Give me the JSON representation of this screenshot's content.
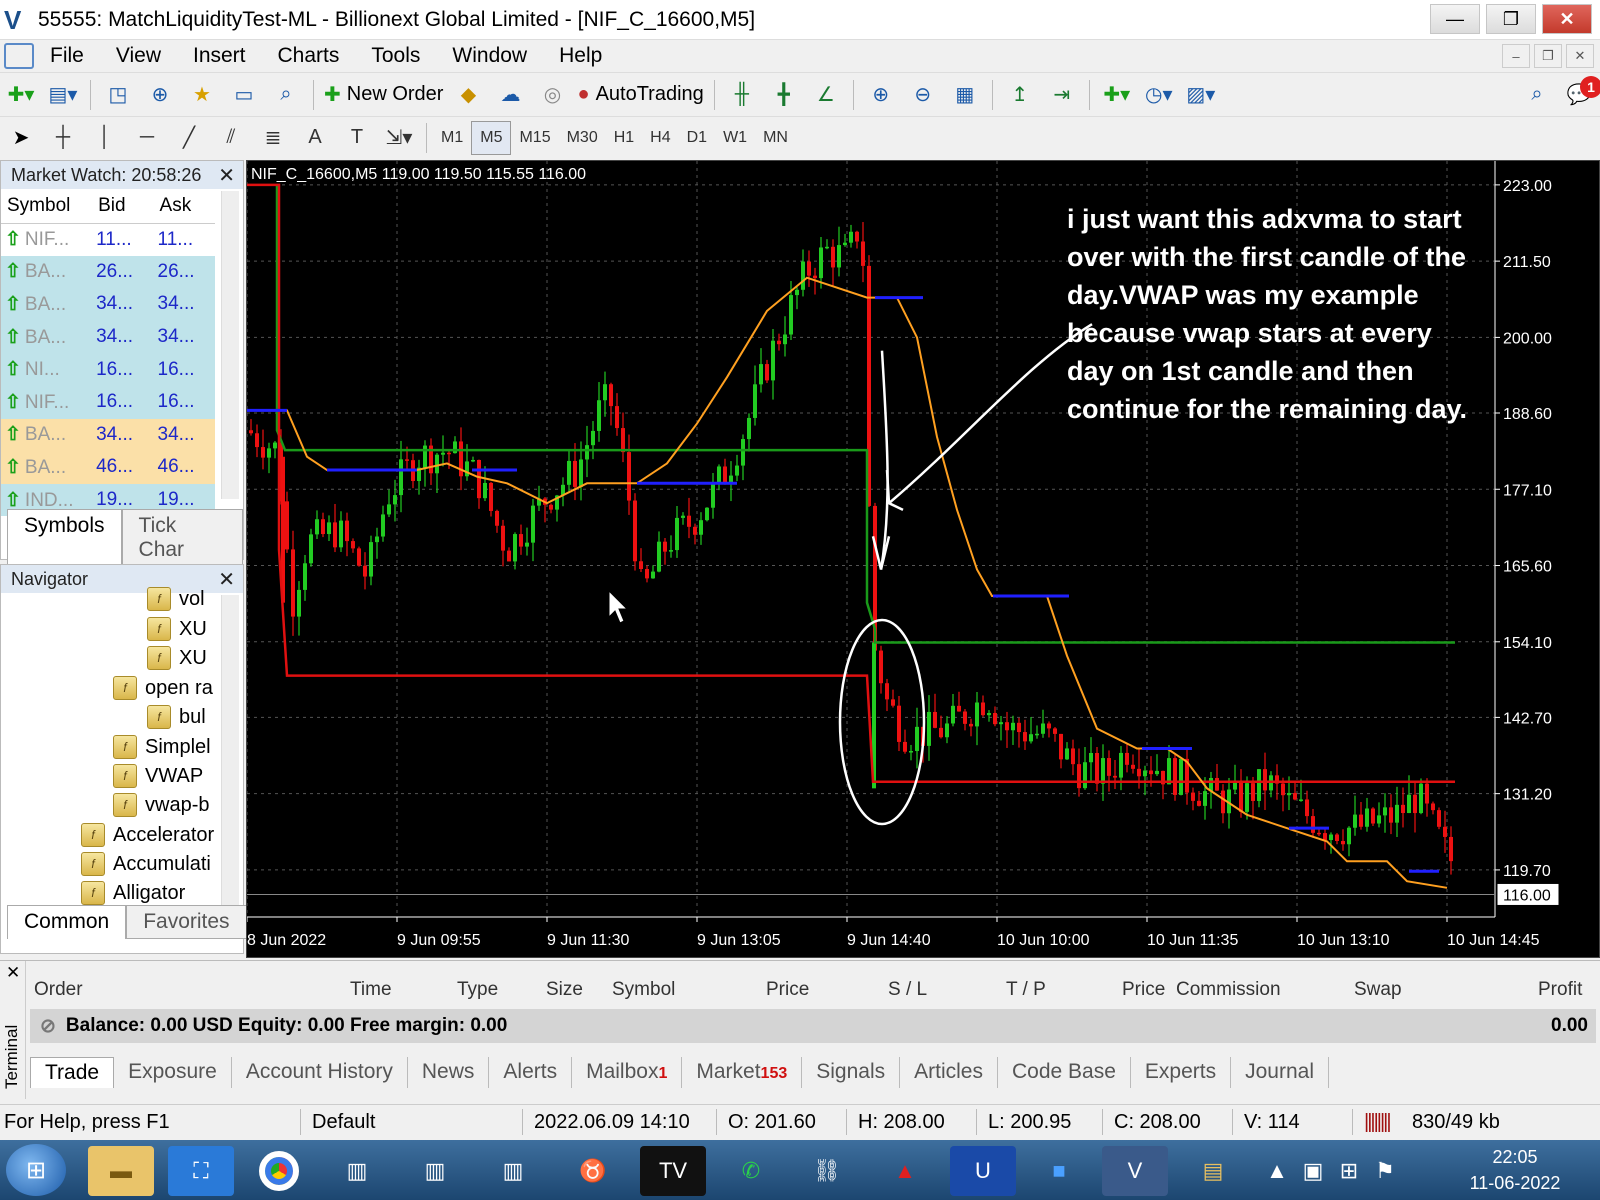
{
  "window": {
    "title": "55555: MatchLiquidityTest-ML - Billionext Global Limited - [NIF_C_16600,M5]",
    "minimize": "—",
    "restore": "❐",
    "close": "✕"
  },
  "menu": [
    "File",
    "View",
    "Insert",
    "Charts",
    "Tools",
    "Window",
    "Help"
  ],
  "toolbar": {
    "new_order": "New Order",
    "auto_trading": "AutoTrading",
    "notification_count": "1",
    "timeframes": [
      "M1",
      "M5",
      "M15",
      "M30",
      "H1",
      "H4",
      "D1",
      "W1",
      "MN"
    ],
    "active_timeframe": "M5"
  },
  "market_watch": {
    "title": "Market Watch: 20:58:26",
    "columns": [
      "Symbol",
      "Bid",
      "Ask"
    ],
    "rows": [
      {
        "symbol": "NIF...",
        "bid": "11...",
        "ask": "11...",
        "bg": "#ffffff"
      },
      {
        "symbol": "BA...",
        "bid": "26...",
        "ask": "26...",
        "bg": "#bfe3ea"
      },
      {
        "symbol": "BA...",
        "bid": "34...",
        "ask": "34...",
        "bg": "#bfe3ea"
      },
      {
        "symbol": "BA...",
        "bid": "34...",
        "ask": "34...",
        "bg": "#bfe3ea"
      },
      {
        "symbol": "NI...",
        "bid": "16...",
        "ask": "16...",
        "bg": "#bfe3ea"
      },
      {
        "symbol": "NIF...",
        "bid": "16...",
        "ask": "16...",
        "bg": "#bfe3ea"
      },
      {
        "symbol": "BA...",
        "bid": "34...",
        "ask": "34...",
        "bg": "#fbe0a8"
      },
      {
        "symbol": "BA...",
        "bid": "46...",
        "ask": "46...",
        "bg": "#fbe0a8"
      },
      {
        "symbol": "IND...",
        "bid": "19...",
        "ask": "19...",
        "bg": "#bfe3ea"
      }
    ],
    "tabs": [
      "Symbols",
      "Tick Char"
    ]
  },
  "navigator": {
    "title": "Navigator",
    "items": [
      "vol",
      "XU",
      "XU",
      "open ra",
      "bul",
      "Simplel",
      "VWAP",
      "vwap-b",
      "Accelerator",
      "Accumulati",
      "Alligator"
    ],
    "tabs": [
      "Common",
      "Favorites"
    ]
  },
  "chart": {
    "header": "NIF_C_16600,M5  119.00 119.50 115.55 116.00",
    "annotation": [
      "i just want this adxvma to start",
      "over with the first candle of the",
      "day.VWAP was my example",
      "because vwap stars at every",
      "day on 1st candle and then",
      "continue for the remaining day."
    ],
    "current_price": "116.00"
  },
  "chart_data": {
    "type": "candlestick",
    "symbol": "NIF_C_16600",
    "timeframe": "M5",
    "ohlc_header": {
      "open": 119.0,
      "high": 119.5,
      "low": 115.55,
      "close": 116.0
    },
    "y_ticks": [
      "223.00",
      "211.50",
      "200.00",
      "188.60",
      "177.10",
      "165.60",
      "154.10",
      "142.70",
      "131.20",
      "119.70"
    ],
    "ylim": [
      112.6,
      226.6
    ],
    "x_ticks": [
      "8 Jun 2022",
      "9 Jun 09:55",
      "9 Jun 11:30",
      "9 Jun 13:05",
      "9 Jun 14:40",
      "10 Jun 10:00",
      "10 Jun 11:35",
      "10 Jun 13:10",
      "10 Jun 14:45"
    ],
    "colors": {
      "bull": "#22cc22",
      "bear": "#ee1111",
      "adxvma": "#ffa020",
      "adxvma_flat": "#2020ff",
      "vwap_green": "#1a9a1a",
      "vwap_red": "#e01010",
      "annotation": "#ffffff"
    }
  },
  "terminal": {
    "side_label": "Terminal",
    "columns": [
      "Order",
      "Time",
      "Type",
      "Size",
      "Symbol",
      "Price",
      "S / L",
      "T / P",
      "Price",
      "Commission",
      "Swap",
      "Profit"
    ],
    "balance": "Balance: 0.00 USD  Equity: 0.00  Free margin: 0.00",
    "profit": "0.00",
    "tabs": [
      {
        "label": "Trade",
        "count": ""
      },
      {
        "label": "Exposure",
        "count": ""
      },
      {
        "label": "Account History",
        "count": ""
      },
      {
        "label": "News",
        "count": ""
      },
      {
        "label": "Alerts",
        "count": ""
      },
      {
        "label": "Mailbox",
        "count": "1"
      },
      {
        "label": "Market",
        "count": "153"
      },
      {
        "label": "Signals",
        "count": ""
      },
      {
        "label": "Articles",
        "count": ""
      },
      {
        "label": "Code Base",
        "count": ""
      },
      {
        "label": "Experts",
        "count": ""
      },
      {
        "label": "Journal",
        "count": ""
      }
    ]
  },
  "status": {
    "help": "For Help, press F1",
    "profile": "Default",
    "datetime": "2022.06.09 14:10",
    "open": "O: 201.60",
    "high": "H: 208.00",
    "low": "L: 200.95",
    "close": "C: 208.00",
    "volume": "V: 114",
    "traffic": "830/49 kb"
  },
  "taskbar": {
    "time": "22:05",
    "date": "11-06-2022"
  }
}
